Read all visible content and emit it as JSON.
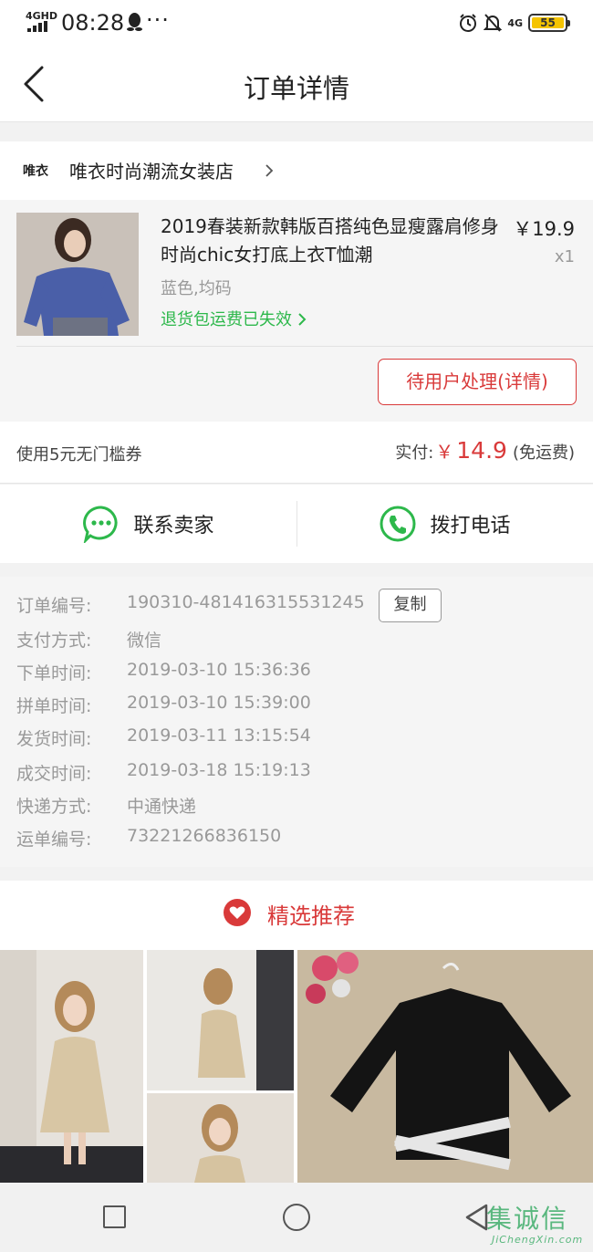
{
  "status_bar": {
    "network": "4GHD",
    "time": "08:28",
    "more": "···",
    "network_right": "4G",
    "battery": "55"
  },
  "nav": {
    "title": "订单详情"
  },
  "shop": {
    "logo_text": "唯衣",
    "name": "唯衣时尚潮流女装店"
  },
  "product": {
    "name": "2019春装新款韩版百搭纯色显瘦露肩修身时尚chic女打底上衣T恤潮",
    "price": "￥19.9",
    "quantity": "x1",
    "spec": "蓝色,均码",
    "return_notice": "退货包运费已失效",
    "pending_button": "待用户处理(详情)"
  },
  "payment": {
    "coupon": "使用5元无门槛券",
    "paid_label": "实付:",
    "currency": "￥",
    "amount": "14.9",
    "shipping_note": "(免运费)"
  },
  "contact": {
    "seller_label": "联系卖家",
    "phone_label": "拨打电话",
    "accent_color": "#2db84b"
  },
  "order_info": {
    "copy_label": "复制",
    "rows": [
      {
        "label": "订单编号:",
        "value": "190310-481416315531245"
      },
      {
        "label": "支付方式:",
        "value": "微信"
      },
      {
        "label": "下单时间:",
        "value": "2019-03-10 15:36:36"
      },
      {
        "label": "拼单时间:",
        "value": "2019-03-10 15:39:00"
      },
      {
        "label": "发货时间:",
        "value": "2019-03-11 13:15:54"
      },
      {
        "label": "成交时间:",
        "value": "2019-03-18 15:19:13"
      },
      {
        "label": "快递方式:",
        "value": "中通快递"
      },
      {
        "label": "运单编号:",
        "value": "73221266836150"
      }
    ]
  },
  "recommend": {
    "title": "精选推荐",
    "accent_color": "#d93a3a"
  },
  "watermark": {
    "main": "集诚信",
    "sub": "JiChengXin.com"
  },
  "icons": {
    "back": "back-arrow-icon",
    "chat": "chat-bubble-icon",
    "phone": "phone-icon",
    "heart": "heart-badge-icon",
    "nav_recent": "square-icon",
    "nav_home": "circle-icon",
    "nav_back": "triangle-back-icon"
  }
}
